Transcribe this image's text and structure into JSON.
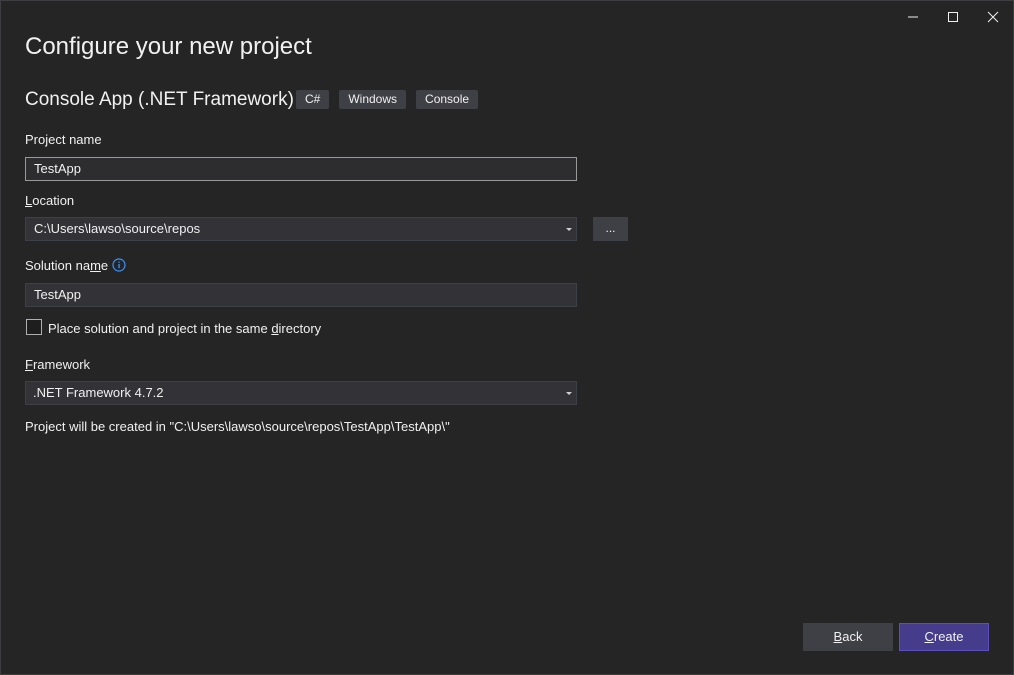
{
  "dialog": {
    "title": "Configure your new project",
    "template_name": "Console App (.NET Framework)",
    "tags": [
      "C#",
      "Windows",
      "Console"
    ]
  },
  "project_name": {
    "label": "Project name",
    "value": "TestApp"
  },
  "location": {
    "label_accel": "L",
    "label_rest": "ocation",
    "value": "C:\\Users\\lawso\\source\\repos",
    "browse_label": "..."
  },
  "solution_name": {
    "label_pre": "Solution na",
    "label_accel": "m",
    "label_post": "e",
    "value": "TestApp"
  },
  "same_dir_checkbox": {
    "label_pre": "Place solution and project in the same ",
    "label_accel": "d",
    "label_post": "irectory",
    "checked": false
  },
  "framework": {
    "label_accel": "F",
    "label_rest": "ramework",
    "value": ".NET Framework 4.7.2"
  },
  "creation_path": "Project will be created in \"C:\\Users\\lawso\\source\\repos\\TestApp\\TestApp\\\"",
  "buttons": {
    "back_accel": "B",
    "back_rest": "ack",
    "create_accel": "C",
    "create_rest": "reate"
  },
  "icons": {
    "minimize": "minimize-icon",
    "maximize": "maximize-icon",
    "close": "close-icon",
    "info": "info-icon"
  },
  "colors": {
    "background": "#252526",
    "create_button": "#463c8c",
    "info_icon": "#3794ff"
  }
}
